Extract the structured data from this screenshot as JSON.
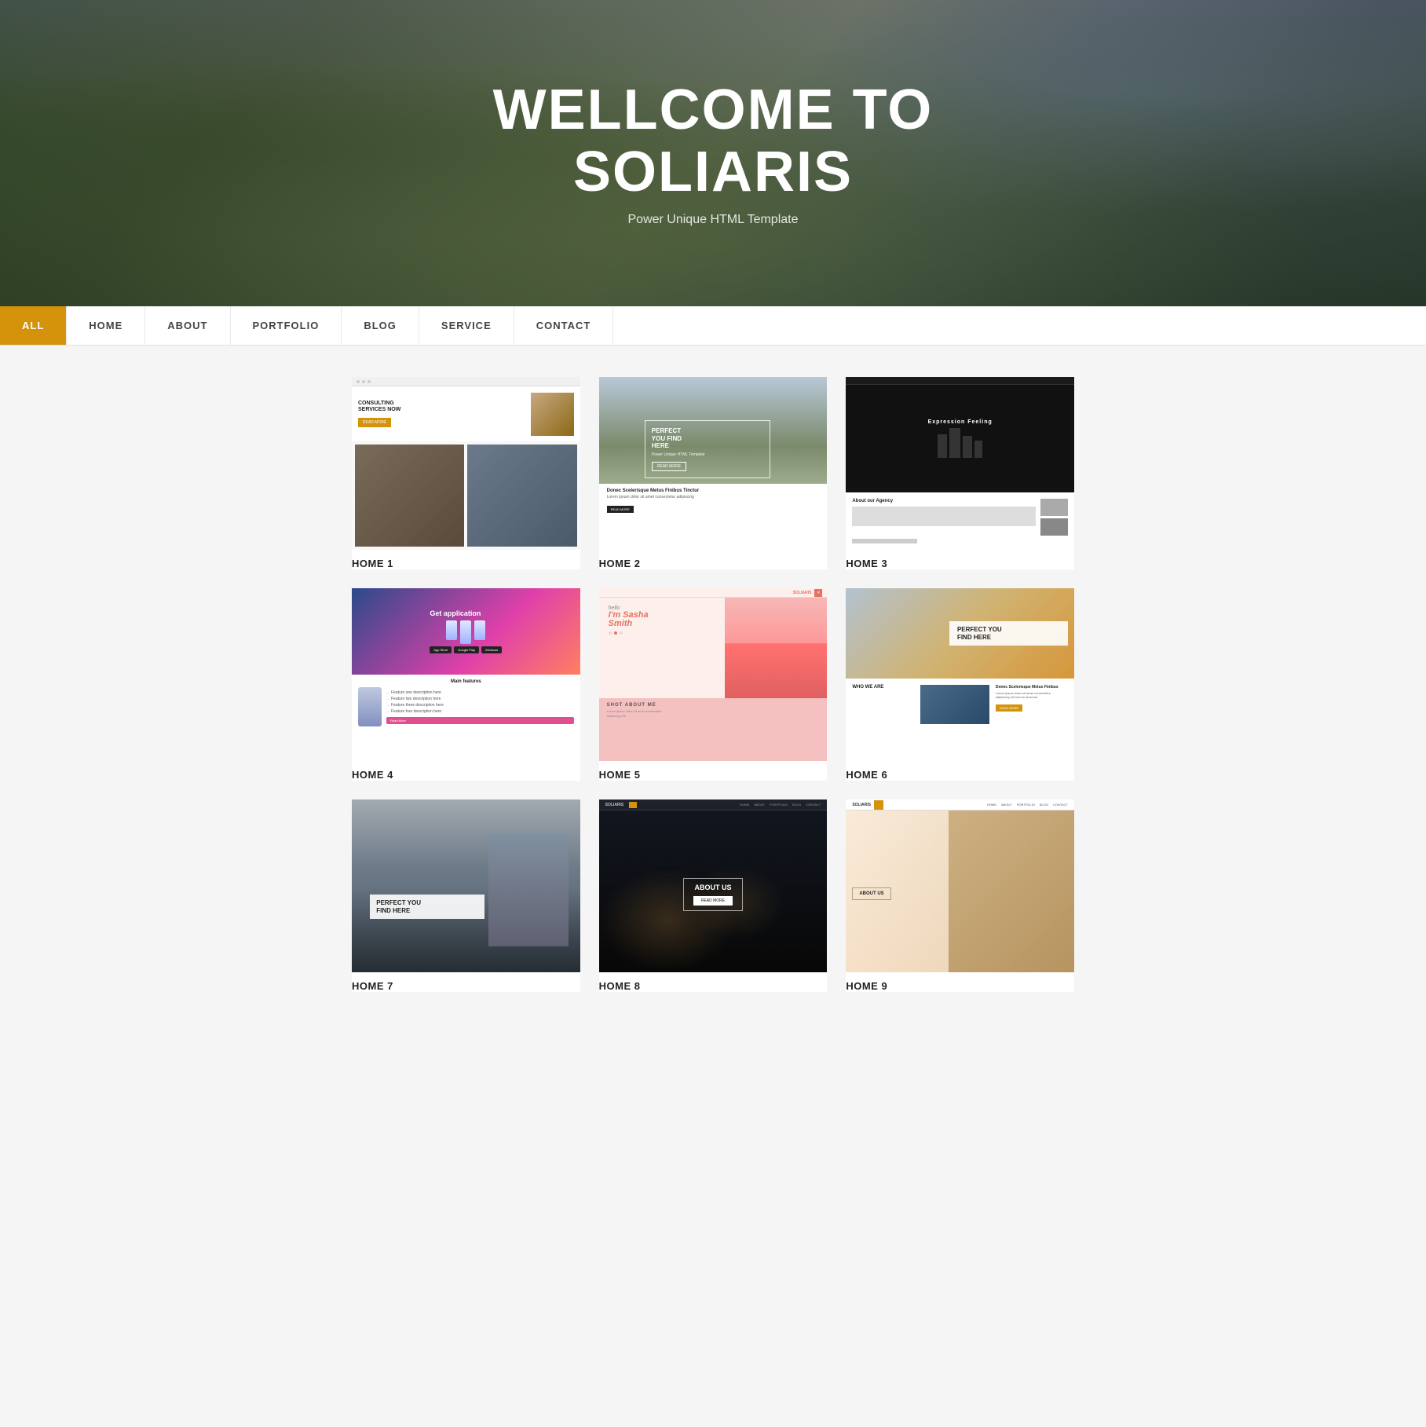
{
  "hero": {
    "title_line1": "WELLCOME TO",
    "title_line2": "SOLIARIS",
    "subtitle": "Power Unique HTML Template"
  },
  "nav": {
    "items": [
      {
        "label": "ALL",
        "active": true
      },
      {
        "label": "HOME",
        "active": false
      },
      {
        "label": "ABOUT",
        "active": false
      },
      {
        "label": "PORTFOLIO",
        "active": false
      },
      {
        "label": "BLOG",
        "active": false
      },
      {
        "label": "SERVICE",
        "active": false
      },
      {
        "label": "CONTACT",
        "active": false
      }
    ]
  },
  "cards": [
    {
      "id": "home1",
      "label": "HOME 1",
      "thumb_type": "t1",
      "content": {
        "title": "CONSULTING SERVICES NOW",
        "btn": "READ MORE"
      }
    },
    {
      "id": "home2",
      "label": "HOME 2",
      "thumb_type": "t2",
      "content": {
        "title": "PERFECT YOU FIND HERE",
        "sub": "Power Unique HTML Template",
        "small_title": "Donec Scelerisque Metus Finibus Tinctur",
        "small_text": "Lorem ipsum dolor sit amet consectetur"
      }
    },
    {
      "id": "home3",
      "label": "HOME 3",
      "thumb_type": "t3",
      "content": {
        "title": "Expression Feeling",
        "agency": "About our Agency"
      }
    },
    {
      "id": "home4",
      "label": "HOME 4",
      "thumb_type": "t4",
      "content": {
        "title": "Get application",
        "features_title": "Main features"
      }
    },
    {
      "id": "home5",
      "label": "HOME 5",
      "thumb_type": "t5",
      "content": {
        "hi": "hello",
        "name": "I'm Sasha Smith",
        "about_title": "SHOT ABOUT ME"
      }
    },
    {
      "id": "home6",
      "label": "HOME 6",
      "thumb_type": "t6",
      "content": {
        "title": "PERFECT YOU FIND HERE",
        "who": "WHO WE ARE",
        "sub_title": "Donec Scelerisque Metus Finibus"
      }
    },
    {
      "id": "home7",
      "label": "HOME 7",
      "thumb_type": "t7",
      "content": {
        "title": "PERFECT YOU FIND HERE"
      }
    },
    {
      "id": "home8",
      "label": "HOME 8",
      "thumb_type": "t8",
      "content": {
        "title": "ABOUT US",
        "nav": [
          "HOME",
          "ABOUT",
          "PORTFOLIO",
          "BLOG",
          "CONTACT"
        ]
      }
    },
    {
      "id": "home9",
      "label": "HOME 9",
      "thumb_type": "t9",
      "content": {
        "title": "ABOUT US"
      }
    }
  ],
  "colors": {
    "accent": "#d4930a",
    "dark": "#111111",
    "white": "#ffffff"
  }
}
